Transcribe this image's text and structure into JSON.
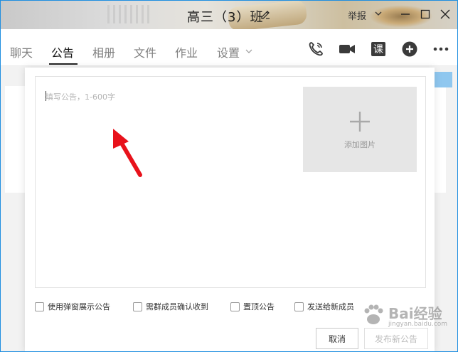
{
  "window": {
    "title": "高三（3）班",
    "report_label": "举报"
  },
  "tabs": [
    {
      "label": "聊天"
    },
    {
      "label": "公告"
    },
    {
      "label": "相册"
    },
    {
      "label": "文件"
    },
    {
      "label": "作业"
    },
    {
      "label": "设置"
    }
  ],
  "toolbar_icons": [
    "phone-call-icon",
    "video-call-icon",
    "class-icon",
    "add-icon",
    "more-icon"
  ],
  "class_icon_glyph": "课",
  "dialog": {
    "placeholder": "填写公告，1-600字",
    "add_image_label": "添加图片",
    "options": [
      {
        "label": "使用弹窗展示公告",
        "checked": false
      },
      {
        "label": "需群成员确认收到",
        "checked": false
      },
      {
        "label": "置顶公告",
        "checked": false
      },
      {
        "label": "发送给新成员",
        "checked": false
      }
    ],
    "cancel_label": "取消",
    "publish_label": "发布新公告"
  },
  "watermark": {
    "text": "Bai经验",
    "sub": "jingyan.baidu.com"
  },
  "colors": {
    "accent_border": "#1e8ee0",
    "annotation_arrow": "#e8121b"
  }
}
